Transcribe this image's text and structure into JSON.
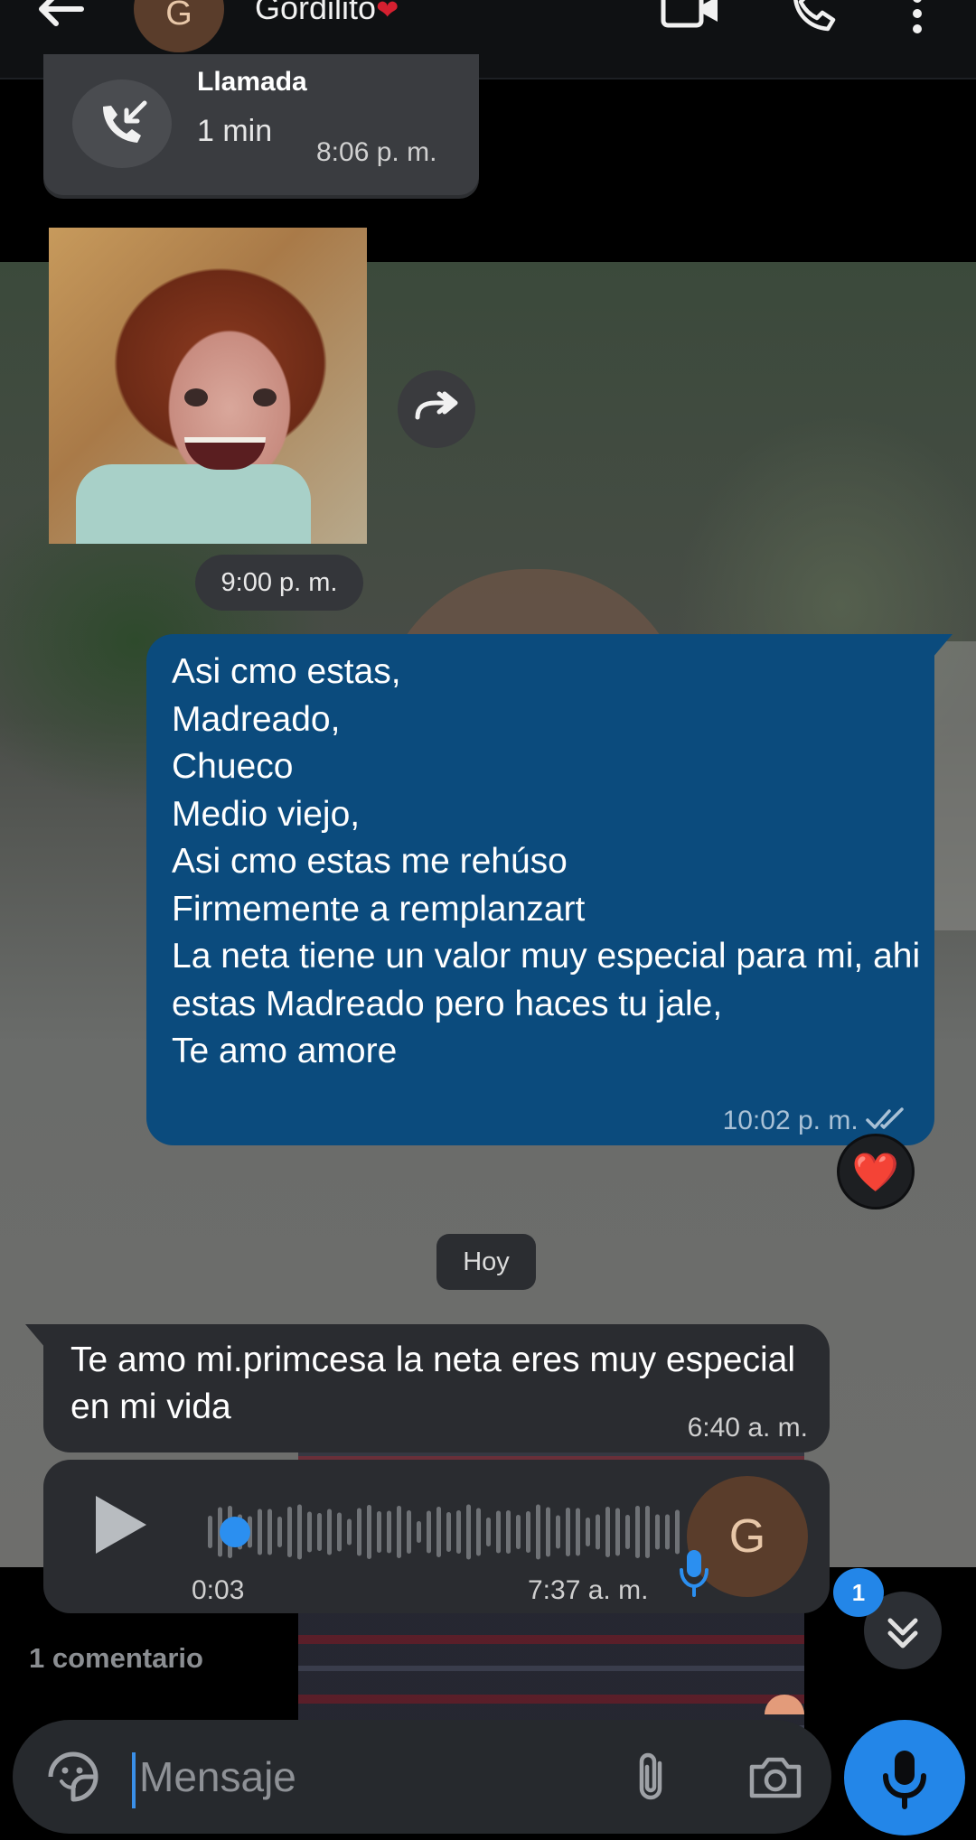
{
  "header": {
    "avatar_letter": "G",
    "contact_name": "Gordilito",
    "contact_emoji": "❤",
    "icons": [
      "back-arrow-icon",
      "video-call-icon",
      "phone-icon",
      "more-vertical-icon"
    ]
  },
  "call_card": {
    "title": "Llamada",
    "duration": "1 min",
    "time": "8:06 p. m."
  },
  "photo_message": {
    "time": "9:00 p. m."
  },
  "outgoing_message": {
    "text": "Asi cmo estas,\nMadreado,\nChueco\nMedio viejo,\nAsi cmo estas me rehúso\nFirmemente a remplanzart\nLa neta tiene un valor muy especial para mi, ahi estas Madreado pero haces tu jale,\nTe amo amore",
    "time": "10:02 p. m.",
    "status": "read",
    "reaction": "❤️"
  },
  "day_separator": "Hoy",
  "incoming_message": {
    "text": "Te amo mi.primcesa la neta eres muy especial en mi vida",
    "time": "6:40 a. m."
  },
  "voice_message": {
    "duration": "0:03",
    "time": "7:37 a. m.",
    "progress": 0.0,
    "avatar_letter": "G"
  },
  "unread_count": "1",
  "comments_label": "1 comentario",
  "composer": {
    "placeholder": "Mensaje"
  },
  "colors": {
    "outgoing_bubble": "#0b4b7d",
    "incoming_bubble": "#2a2c30",
    "accent": "#2386e8"
  }
}
